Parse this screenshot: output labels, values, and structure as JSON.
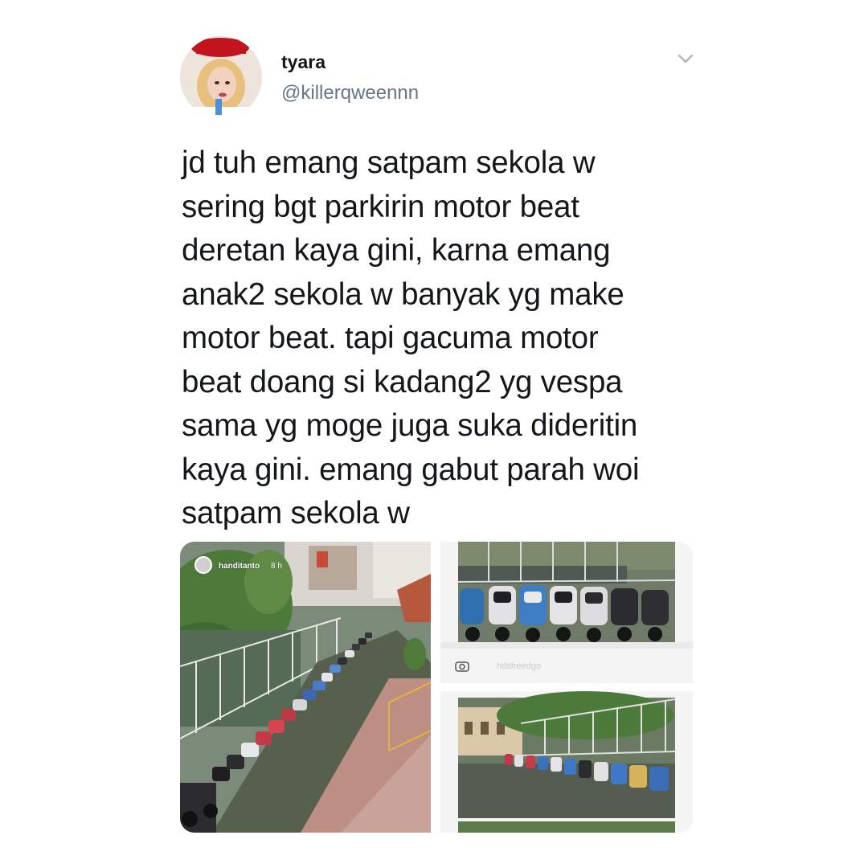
{
  "tweet": {
    "display_name": "tyara",
    "handle": "@killerqweennn",
    "text": "jd tuh emang satpam sekola w\nsering bgt parkirin motor beat\nderetan kaya gini, karna emang\nanak2 sekola w banyak yg make\nmotor beat. tapi gacuma motor\nbeat doang si kadang2 yg vespa\nsama yg moge juga suka dideritin\nkaya gini. emang gabut parah woi\nsatpam sekola w",
    "menu_icon": "chevron-down-icon"
  },
  "media": {
    "photo1": {
      "story_user": "handitanto",
      "story_time": "8 h"
    },
    "photo2": {
      "camera_icon": "camera-icon",
      "faded_handle": "hdsfreedgo"
    }
  },
  "colors": {
    "text_primary": "#14171a",
    "text_secondary": "#657786",
    "chevron": "#aab8c2"
  }
}
